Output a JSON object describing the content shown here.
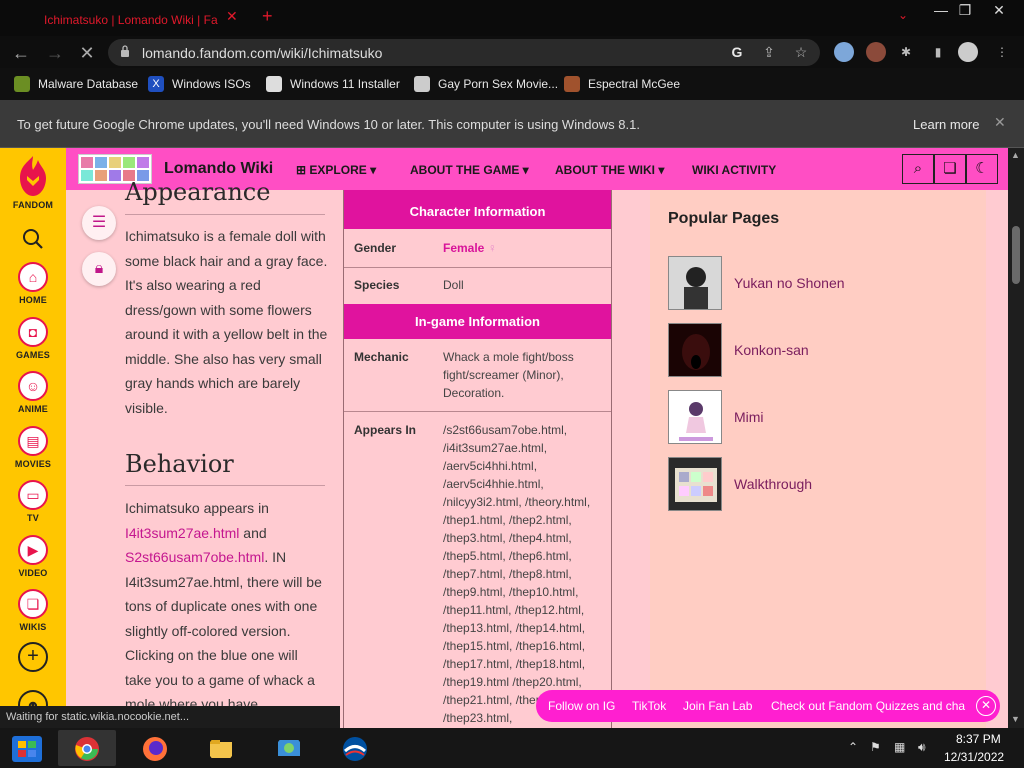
{
  "browser": {
    "tab_title": "Ichimatsuko | Lomando Wiki | Fa",
    "tab_close": "✕",
    "new_tab": "+",
    "url": "lomando.fandom.com/wiki/Ichimatsuko",
    "bookmarks": [
      {
        "label": "Malware Database"
      },
      {
        "label": "Windows ISOs"
      },
      {
        "label": "Windows 11 Installer"
      },
      {
        "label": "Gay Porn Sex Movie..."
      },
      {
        "label": "Espectral McGee"
      }
    ],
    "infobar_text": "To get future Google Chrome updates, you'll need Windows 10 or later. This computer is using Windows 8.1.",
    "learn_more": "Learn more",
    "status_text": "Waiting for static.wikia.nocookie.net..."
  },
  "fandom_rail": {
    "brand": "FANDOM",
    "items": [
      {
        "label": "HOME"
      },
      {
        "label": "GAMES"
      },
      {
        "label": "ANIME"
      },
      {
        "label": "MOVIES"
      },
      {
        "label": "TV"
      },
      {
        "label": "VIDEO"
      },
      {
        "label": "WIKIS"
      }
    ]
  },
  "wiki_header": {
    "name": "Lomando Wiki",
    "nav": [
      "EXPLORE",
      "ABOUT THE GAME",
      "ABOUT THE WIKI",
      "WIKI ACTIVITY"
    ]
  },
  "article": {
    "heading_appearance": "Appearance",
    "appearance_text": "Ichimatsuko is a female doll with some black hair and a gray face. It's also wearing a red dress/gown with some flowers around it with a yellow belt in the middle. She also has very small gray hands which are barely visible.",
    "heading_behavior": "Behavior",
    "behavior_intro": "Ichimatsuko appears in",
    "behavior_link1": "I4it3sum27ae.html",
    "behavior_and": "and",
    "behavior_link2": "S2st66usam7obe.html",
    "behavior_rest": ". IN I4it3sum27ae.html, there will be tons of duplicate ones with one slightly off-colored version. Clicking on the blue one will take you to a game of whack a mole where you have"
  },
  "infobox": {
    "section1": "Character Information",
    "gender_label": "Gender",
    "gender_value": "Female",
    "gender_symbol": "♀",
    "species_label": "Species",
    "species_value": "Doll",
    "section2": "In-game Information",
    "mechanic_label": "Mechanic",
    "mechanic_value": "Whack a mole fight/boss fight/screamer (Minor), Decoration.",
    "appears_label": "Appears In",
    "appears_value": "/s2st66usam7obe.html, /i4it3sum27ae.html, /aerv5ci4hhi.html, /aerv5ci4hhie.html, /nilcyy3i2.html, /theory.html, /thep1.html, /thep2.html, /thep3.html, /thep4.html, /thep5.html, /thep6.html, /thep7.html, /thep8.html, /thep9.html, /thep10.html, /thep11.html, /thep12.html, /thep13.html, /thep14.html, /thep15.html, /thep16.html, /thep17.html, /thep18.html, /thep19.html /thep20.html, /thep21.html, /thep22.html, /thep23.html,"
  },
  "popular": {
    "title": "Popular Pages",
    "items": [
      {
        "label": "Yukan no Shonen"
      },
      {
        "label": "Konkon-san"
      },
      {
        "label": "Mimi"
      },
      {
        "label": "Walkthrough"
      }
    ]
  },
  "sticky_bar": {
    "links": [
      "Follow on IG",
      "TikTok",
      "Join Fan Lab",
      "Check out Fandom Quizzes and cha"
    ]
  },
  "taskbar": {
    "time": "8:37 PM",
    "date": "12/31/2022"
  },
  "colors": {
    "page_bg": "#ffcbd1",
    "header_pink": "#ff4ec4",
    "rail_yellow": "#ffc600",
    "infobox_magenta": "#e0139e",
    "sticky_pink": "#ff1fd0"
  }
}
